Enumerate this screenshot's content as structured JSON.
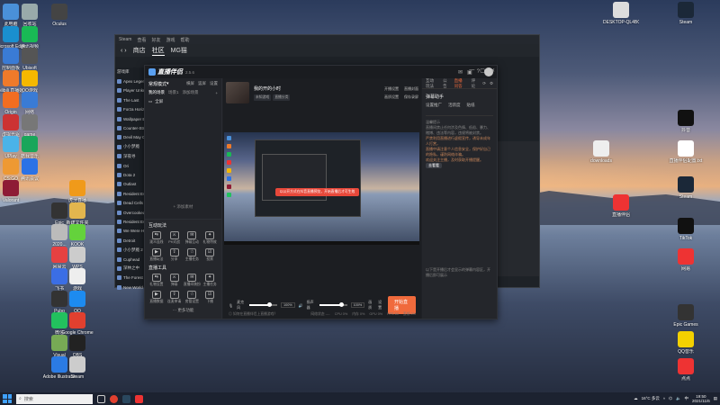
{
  "desktop": {
    "left_icons": [
      {
        "label": "此电脑",
        "color": "#4a90d9"
      },
      {
        "label": "回收站",
        "color": "#9aa"
      },
      {
        "label": "Microsoft Edge",
        "color": "#1a8fcf"
      },
      {
        "label": "腾讯视频",
        "color": "#19b955"
      },
      {
        "label": "控制面板",
        "color": "#3a7bd5"
      },
      {
        "label": "Ubisoft",
        "color": "#555"
      },
      {
        "label": "bilibili 直播姬",
        "color": "#ef7a2a"
      },
      {
        "label": "QQ游戏",
        "color": "#f5b800"
      },
      {
        "label": "Origin",
        "color": "#f26d21"
      },
      {
        "label": "网络",
        "color": "#3a7bd5"
      },
      {
        "label": "虚拟光驱",
        "color": "#c33"
      },
      {
        "label": "game",
        "color": "#777"
      },
      {
        "label": "UPlay",
        "color": "#4ab3e8"
      },
      {
        "label": "酷我音乐",
        "color": "#19a65a"
      },
      {
        "label": "CS:GO",
        "color": "#e93"
      },
      {
        "label": "腾讯会议",
        "color": "#2b72e6"
      },
      {
        "label": "Valorant",
        "color": "#8e1b35"
      },
      {
        "label": "虎牙直播",
        "color": "#f09a1a"
      },
      {
        "label": "Epic",
        "color": "#333"
      },
      {
        "label": "新建文件夹",
        "color": "#e3b64e"
      },
      {
        "label": "2020...",
        "color": "#bbb"
      },
      {
        "label": "KOOK",
        "color": "#64d23c"
      },
      {
        "label": "网易云",
        "color": "#e64141"
      },
      {
        "label": "WPS",
        "color": "#ccc"
      },
      {
        "label": "飞书",
        "color": "#3b6ee5"
      },
      {
        "label": "游戏",
        "color": "#eee"
      },
      {
        "label": "Pubg",
        "color": "#333"
      },
      {
        "label": "QQ",
        "color": "#1d8bf0"
      },
      {
        "label": "微信",
        "color": "#22c15e"
      },
      {
        "label": "Google Chrome",
        "color": "#e1402f"
      },
      {
        "label": "Visual",
        "color": "#7a5"
      },
      {
        "label": "OBS",
        "color": "#222"
      },
      {
        "label": "Adobe Illustrator",
        "color": "#2b7be4"
      },
      {
        "label": "Steam",
        "color": "#ccc"
      },
      {
        "label": "Oculus",
        "color": "#444"
      }
    ],
    "right_icons": [
      {
        "label": "DESKTOP-QL4BOOS",
        "color": "#ddd"
      },
      {
        "label": "downloads",
        "color": "#eee"
      },
      {
        "label": "直播伴侣",
        "color": "#e33"
      },
      {
        "label": "Steam",
        "color": "#1b2838"
      },
      {
        "label": "抖音",
        "color": "#111"
      },
      {
        "label": "直播伴侣配置.txt",
        "color": "#fff"
      },
      {
        "label": "Steam",
        "color": "#1b2838"
      },
      {
        "label": "TikTok",
        "color": "#111"
      },
      {
        "label": "网易",
        "color": "#e33"
      },
      {
        "label": "Epic Games",
        "color": "#333"
      },
      {
        "label": "QQ音乐",
        "color": "#f3d100"
      },
      {
        "label": "点点",
        "color": "#e33"
      }
    ]
  },
  "back_window": {
    "title": "Steam",
    "menu": [
      "商店",
      "社区",
      "MG猫"
    ],
    "menu_small": [
      "Steam",
      "查看",
      "好友",
      "游戏",
      "帮助"
    ],
    "list_header": "游戏库",
    "games": [
      "Apex Legends",
      "Player Unknown",
      "The Last",
      "Forza Horizon",
      "Wallpaper Engine",
      "Counter-Strike",
      "Devil May Cry",
      "小小梦魇",
      "深夜寻",
      "Ori",
      "Dota 2",
      "Outlast",
      "Resident Evil",
      "Dead Cells",
      "Overcooked",
      "Resident Evil 8",
      "We Were Here",
      "Detroit",
      "小小梦魇 2",
      "Cuphead",
      "深林之中",
      "The Forest",
      "New World",
      "Monster Hunter",
      "Outlast 2",
      "九月",
      "Paladins",
      "Ori 2"
    ],
    "right_label": "已安装"
  },
  "app": {
    "name": "直播伴侣",
    "version": "2.5.6",
    "scene": {
      "title": "常规模式",
      "mode_labels": [
        "横屏",
        "竖屏",
        "设置"
      ],
      "tabs": [
        "我的场景",
        "场景1",
        "添加场景"
      ],
      "item": "全屏",
      "add_source": "+ 添加素材"
    },
    "interact": {
      "title": "互动玩法",
      "tools": [
        "观众连线",
        "PK对战",
        "弹幕互动",
        "礼物特效",
        "直播玩法",
        "分享",
        "主播任务",
        "投票"
      ]
    },
    "anchor_tools": {
      "title": "直播工具",
      "tools": [
        "礼物设置",
        "弹幕",
        "直播间装扮",
        "主播任务",
        "直播数据",
        "连麦申请",
        "房管设置",
        "下播"
      ],
      "more": "更多功能"
    },
    "stream": {
      "title": "我的开的小时",
      "tags": [
        "未知游戏",
        "直播分类"
      ],
      "actions": [
        "开播设置",
        "直播封面",
        "画质设置",
        "保存录屏"
      ]
    },
    "preview_toast": "以公开方式在抖音直播预览，开始直播后才可生效",
    "mixer": {
      "mic_label": "麦克风",
      "mic_pct": "100%",
      "mic_level": 0.62,
      "speaker_label": "扬声器",
      "speaker_pct": "100%",
      "speaker_level": 0.68,
      "buttons": [
        "画质",
        "设置"
      ],
      "go_live": "开始直播"
    },
    "status": {
      "left": "◎ 如何在直播伴侣上直播游戏？",
      "items": [
        "网络状态 ----",
        "CPU 0%",
        "内存 0%",
        "GPU 0%",
        "FPS 60",
        "丢帧 0%"
      ]
    },
    "right_panel": {
      "tabs": [
        "互动玩法",
        "公告",
        "直播问答",
        "评论"
      ],
      "active_tab": "直播问答",
      "pet_title": "弹幕助手",
      "pet_tabs": [
        "设置推广",
        "活跃度",
        "贴纸"
      ],
      "notice_title": "温馨提示",
      "notice_lines": [
        "直播间禁止任何涉及色情、低俗、暴力、赌博、违法等内容，违规将被封禁。",
        "严禁利用直播进行虚假宣传，诱导未成年人打赏，",
        "直播中请注意个人信息安全，保护好自己的隐私，谨防网络诈骗。",
        "欢迎关注主播，及时获取开播提醒。"
      ],
      "notice_pill": "去看看",
      "bottom_note": "以下是开播后才会显示的弹幕内容区，开播后即可展示"
    }
  },
  "taskbar": {
    "search_placeholder": "搜索",
    "weather": "16°C 多云",
    "lang": "中",
    "time": "19:50",
    "date": "2021/11/6"
  }
}
